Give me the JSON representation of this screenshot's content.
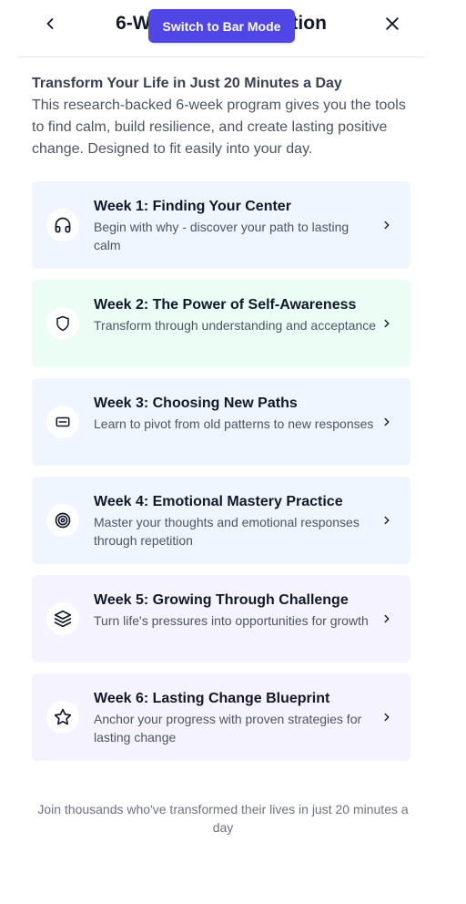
{
  "header": {
    "title": "6-Week Transformation",
    "bar_mode_label": "Switch to Bar Mode"
  },
  "intro": {
    "heading": "Transform Your Life in Just 20 Minutes a Day",
    "text": "This research-backed 6-week program gives you the tools to find calm, build resilience, and create lasting positive change. Designed to fit easily into your day."
  },
  "weeks": [
    {
      "title": "Week 1: Finding Your Center",
      "desc": "Begin with why - discover your path to lasting calm",
      "icon": "headphones-icon",
      "bg": "#eff6ff"
    },
    {
      "title": "Week 2: The Power of Self-Awareness",
      "desc": "Transform through understanding and acceptance",
      "icon": "shield-icon",
      "bg": "#ecfdf5"
    },
    {
      "title": "Week 3: Choosing New Paths",
      "desc": "Learn to pivot from old patterns to new responses",
      "icon": "card-icon",
      "bg": "#eff6ff"
    },
    {
      "title": "Week 4: Emotional Mastery Practice",
      "desc": "Master your thoughts and emotional responses through repetition",
      "icon": "target-icon",
      "bg": "#eff6ff"
    },
    {
      "title": "Week 5: Growing Through Challenge",
      "desc": "Turn life's pressures into opportunities for growth",
      "icon": "layers-icon",
      "bg": "#f5f3ff"
    },
    {
      "title": "Week 6: Lasting Change Blueprint",
      "desc": "Anchor your progress with proven strategies for lasting change",
      "icon": "star-icon",
      "bg": "#f5f3ff"
    }
  ],
  "footer": {
    "text": "Join thousands who've transformed their lives in just 20 minutes a day"
  },
  "colors": {
    "accent": "#4f46e5"
  }
}
